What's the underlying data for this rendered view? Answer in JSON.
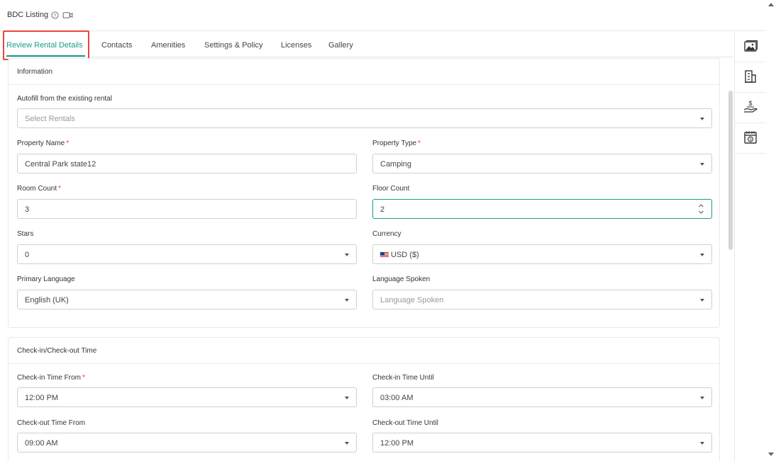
{
  "app": {
    "title": "BDC Listing"
  },
  "tabs": [
    "Review Rental Details",
    "Contacts",
    "Amenities",
    "Settings & Policy",
    "Licenses",
    "Gallery"
  ],
  "information": {
    "header": "Information",
    "autofill": {
      "label": "Autofill from the existing rental",
      "placeholder": "Select Rentals"
    },
    "property_name": {
      "label": "Property Name",
      "value": "Central Park state12",
      "required": "*"
    },
    "property_type": {
      "label": "Property Type",
      "value": "Camping",
      "required": "*"
    },
    "room_count": {
      "label": "Room Count",
      "value": "3",
      "required": "*"
    },
    "floor_count": {
      "label": "Floor Count",
      "value": "2"
    },
    "stars": {
      "label": "Stars",
      "value": "0"
    },
    "currency": {
      "label": "Currency",
      "value": "USD ($)"
    },
    "primary_language": {
      "label": "Primary Language",
      "value": "English (UK)"
    },
    "language_spoken": {
      "label": "Language Spoken",
      "placeholder": "Language Spoken"
    }
  },
  "checkin": {
    "header": "Check-in/Check-out Time",
    "checkin_from": {
      "label": "Check-in Time From",
      "value": "12:00 PM",
      "required": "*"
    },
    "checkin_until": {
      "label": "Check-in Time Until",
      "value": "03:00 AM"
    },
    "checkout_from": {
      "label": "Check-out Time From",
      "value": "09:00 AM"
    },
    "checkout_until": {
      "label": "Check-out Time Until",
      "value": "12:00 PM"
    }
  },
  "right_sidebar": [
    "image-gallery-icon",
    "building-icon",
    "hand-dollar-icon",
    "calendar-dollar-icon"
  ],
  "colors": {
    "accent": "#1a9c8c",
    "highlight": "#e8453c",
    "required": "#e33333"
  }
}
